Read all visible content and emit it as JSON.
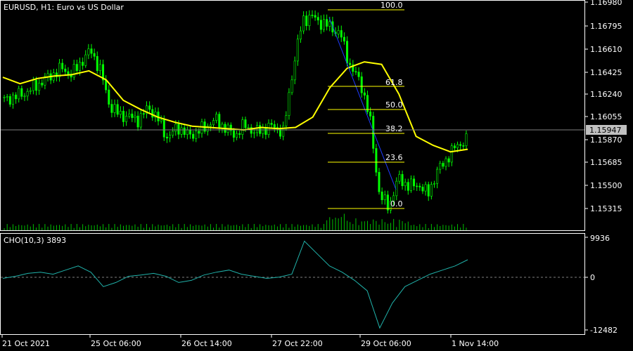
{
  "chart_header": {
    "symbol_label": "EURUSD, H1:  Euro vs US Dollar"
  },
  "indicator_header": {
    "label": "CHO(10,3) 3893"
  },
  "colors": {
    "background": "#000000",
    "frame": "#ffffff",
    "bull_candle": "#00ff00",
    "bear_candle": "#00ff00",
    "ma_line": "#ffff00",
    "fib_line": "#ffff00",
    "fib_trend": "#0000ff",
    "cho_line": "#20b2aa",
    "volume": "#00c000",
    "bid_line": "#7f7f7f",
    "zero_line": "#7f7f7f"
  },
  "price_axis": {
    "ticks": [
      "1.16980",
      "1.16795",
      "1.16610",
      "1.16425",
      "1.16240",
      "1.16055",
      "1.15870",
      "1.15685",
      "1.15500",
      "1.15315"
    ],
    "current_price": "1.15947"
  },
  "indicator_axis": {
    "ticks": [
      "9936",
      "0",
      "-12482"
    ]
  },
  "time_axis": {
    "ticks": [
      "21 Oct 2021",
      "25 Oct 06:00",
      "26 Oct 14:00",
      "27 Oct 22:00",
      "29 Oct 06:00",
      "1 Nov 14:00"
    ]
  },
  "fibonacci": {
    "levels": [
      "100.0",
      "61.8",
      "50.0",
      "38.2",
      "23.6",
      "0.0"
    ]
  },
  "chart_data": [
    {
      "type": "line",
      "title": "EURUSD, H1:  Euro vs US Dollar",
      "x_ticks": [
        "21 Oct 2021",
        "25 Oct 06:00",
        "26 Oct 14:00",
        "27 Oct 22:00",
        "29 Oct 06:00",
        "1 Nov 14:00"
      ],
      "ylim": [
        1.1524,
        1.1702
      ],
      "series": [
        {
          "values": [
            1.1625,
            1.1628,
            1.163,
            1.1635,
            1.164,
            1.1645,
            1.165,
            1.1645,
            1.1655,
            1.1664,
            1.1648,
            1.162,
            1.1614,
            1.1612,
            1.161,
            1.162,
            1.161,
            1.1595,
            1.1605,
            1.1598,
            1.16,
            1.1605,
            1.161,
            1.1603,
            1.1598,
            1.1606,
            1.16,
            1.1603,
            1.1605,
            1.16,
            1.165,
            1.1688,
            1.169,
            1.1685,
            1.1682,
            1.1675,
            1.165,
            1.164,
            1.161,
            1.155,
            1.1543,
            1.1565,
            1.1558,
            1.156,
            1.1552,
            1.157,
            1.158,
            1.159,
            1.1594
          ]
        },
        {
          "values": [
            1.1643,
            1.1638,
            1.1642,
            1.1644,
            1.1645,
            1.1648,
            1.1641,
            1.1625,
            1.1618,
            1.1612,
            1.1608,
            1.1605,
            1.1604,
            1.1603,
            1.1602,
            1.1604,
            1.1603,
            1.1604,
            1.1612,
            1.1635,
            1.165,
            1.1655,
            1.1653,
            1.163,
            1.1597,
            1.159,
            1.1585,
            1.1587
          ]
        }
      ]
    },
    {
      "type": "line",
      "title": "CHO(10,3) 3893",
      "ylim": [
        -12482,
        9936
      ],
      "series": [
        {
          "values": [
            0,
            500,
            1200,
            1500,
            1000,
            2000,
            3000,
            1500,
            -2000,
            -1000,
            500,
            800,
            1200,
            500,
            -1000,
            -500,
            800,
            1500,
            2000,
            1000,
            500,
            0,
            300,
            1000,
            9000,
            6000,
            3000,
            1500,
            -500,
            -3000,
            -12000,
            -6000,
            -2000,
            -500,
            1000,
            2000,
            3000,
            4500
          ]
        }
      ]
    }
  ]
}
